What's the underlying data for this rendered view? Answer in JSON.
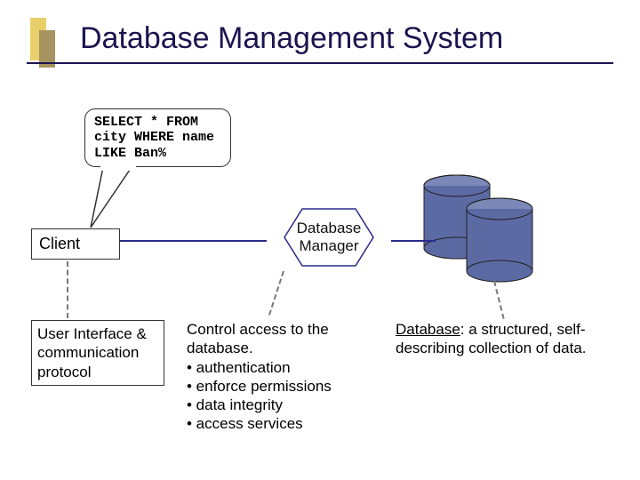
{
  "title": "Database Management System",
  "sql": {
    "line1": "SELECT * FROM",
    "line2": "city WHERE name",
    "line3": "LIKE Ban%"
  },
  "client": {
    "label": "Client"
  },
  "manager": {
    "label_line1": "Database",
    "label_line2": "Manager"
  },
  "connectors": {
    "left": "client-to-manager-line",
    "right": "manager-to-database-line"
  },
  "desc_client": {
    "text": "User Interface & communication protocol"
  },
  "desc_manager": {
    "line1": "Control access to the database.",
    "b1": "• authentication",
    "b2": "• enforce permissions",
    "b3": "• data integrity",
    "b4": "• access services"
  },
  "desc_database": {
    "term": "Database",
    "rest": ": a structured, self-describing collection of data."
  },
  "colors": {
    "cylinder_fill": "#5b6aa3",
    "cylinder_top": "#7b88b8",
    "accent_dark": "#1a1550"
  }
}
